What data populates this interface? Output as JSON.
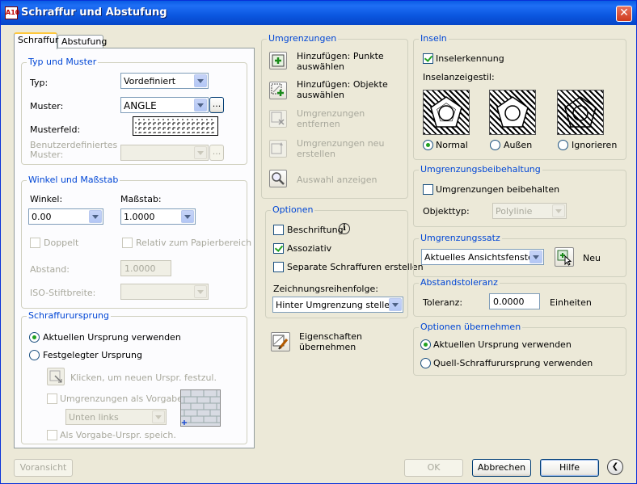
{
  "window": {
    "title": "Schraffur und Abstufung",
    "close_glyph": "✕",
    "app_icon": "A10"
  },
  "tabs": [
    {
      "label": "Schraffur"
    },
    {
      "label": "Abstufung"
    }
  ],
  "typ_muster": {
    "title": "Typ und Muster",
    "typ_label": "Typ:",
    "typ_value": "Vordefiniert",
    "muster_label": "Muster:",
    "muster_value": "ANGLE",
    "browse": "...",
    "musterfeld_label": "Musterfeld:",
    "benutzer_label_1": "Benutzerdefiniertes",
    "benutzer_label_2": "Muster:",
    "benutzer_browse": "..."
  },
  "winkel": {
    "title": "Winkel und Maßstab",
    "winkel_label": "Winkel:",
    "winkel_value": "0.00",
    "massstab_label": "Maßstab:",
    "massstab_value": "1.0000",
    "doppelt": "Doppelt",
    "relativ": "Relativ zum Papierbereich",
    "abstand_label": "Abstand:",
    "abstand_value": "1.0000",
    "iso_label": "ISO-Stiftbreite:"
  },
  "ursprung": {
    "title": "Schraffurursprung",
    "aktuell": "Aktuellen Ursprung verwenden",
    "festgelegt": "Festgelegter Ursprung",
    "klicken": "Klicken, um neuen Urspr. festzul.",
    "umgrenzungen_vorgabe": "Umgrenzungen als Vorgabe",
    "position_value": "Unten links",
    "speich": "Als Vorgabe-Urspr. speich."
  },
  "umgrenzungen": {
    "title": "Umgrenzungen",
    "punkte_1": "Hinzufügen: Punkte",
    "punkte_2": "auswählen",
    "objekte_1": "Hinzufügen: Objekte",
    "objekte_2": "auswählen",
    "entfernen_1": "Umgrenzungen",
    "entfernen_2": "entfernen",
    "neu_1": "Umgrenzungen neu",
    "neu_2": "erstellen",
    "anzeigen": "Auswahl anzeigen"
  },
  "optionen": {
    "title": "Optionen",
    "beschriftung": "Beschriftung",
    "info_glyph": "i",
    "assoziativ": "Assoziativ",
    "separate": "Separate Schraffuren erstellen",
    "reihenfolge_label": "Zeichnungsreihenfolge:",
    "reihenfolge_value": "Hinter Umgrenzung stellen"
  },
  "eigenschaften": {
    "label_1": "Eigenschaften",
    "label_2": "übernehmen"
  },
  "inseln": {
    "title": "Inseln",
    "erkennung": "Inselerkennung",
    "stil_label": "Inselanzeigestil:",
    "normal": "Normal",
    "aussen": "Außen",
    "ignorieren": "Ignorieren"
  },
  "beibehaltung": {
    "title": "Umgrenzungsbeibehaltung",
    "beibehalten": "Umgrenzungen beibehalten",
    "objekttyp_label": "Objekttyp:",
    "objekttyp_value": "Polylinie"
  },
  "satz": {
    "title": "Umgrenzungssatz",
    "value": "Aktuelles Ansichtsfenster",
    "neu": "Neu"
  },
  "toleranz": {
    "title": "Abstandstoleranz",
    "label": "Toleranz:",
    "value": "0.0000",
    "unit": "Einheiten"
  },
  "uebernehmen": {
    "title": "Optionen übernehmen",
    "aktuell": "Aktuellen Ursprung verwenden",
    "quell": "Quell-Schraffurursprung verwenden"
  },
  "footer": {
    "vorschau": "Voransicht",
    "ok": "OK",
    "abbrechen": "Abbrechen",
    "hilfe": "Hilfe",
    "collapse_glyph": "❮"
  }
}
